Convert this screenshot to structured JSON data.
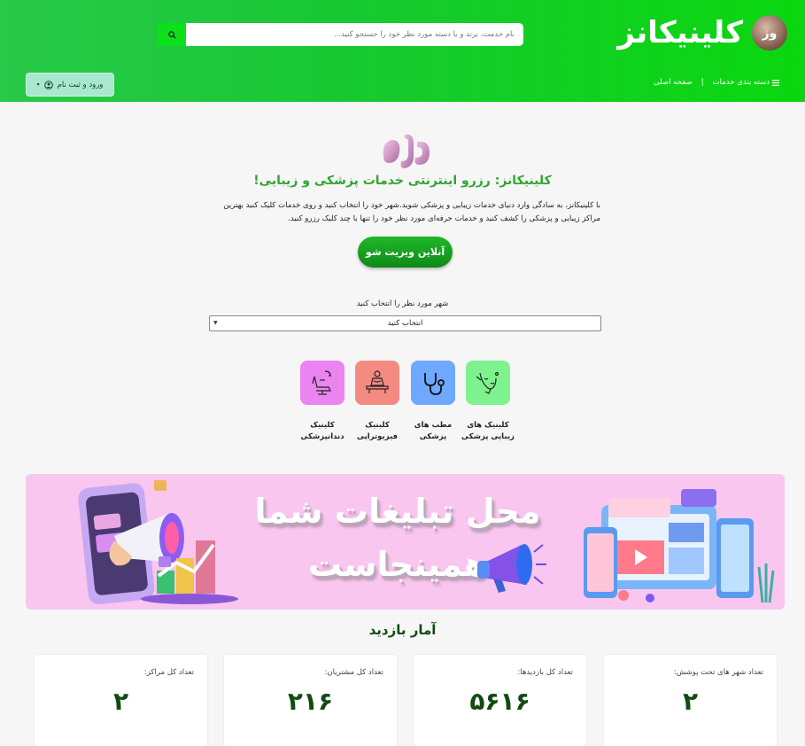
{
  "header": {
    "brand_name": "کلینیکانز",
    "search_placeholder": "نام خدمت، برند و یا دسته مورد نظر خود را جستجو کنید...",
    "nav": {
      "categories_label": "دسته بندی خدمات",
      "home_label": "صفحه اصلی"
    },
    "login_label": "ورود و ثبت نام"
  },
  "hero": {
    "title": "کلینیکانز: رزرو اینترنتی خدمات پزشکی و زیبایی!",
    "description": "با کلینیکانز، به سادگی وارد دنیای خدمات زیبایی و پزشکی شوید.شهر خود را انتخاب کنید و روی خدمات کلیک کنید بهترین مراکز زیبایی و پزشکی را کشف کنید و خدمات حرفه‌ای مورد نظر خود را تنها با چند کلیک رزرو کنید.",
    "cta_label": "آنلاین ویزیت شو"
  },
  "city": {
    "label": "شهر مورد نظر را انتخاب کنید",
    "selected": "انتخاب کنید"
  },
  "categories": [
    {
      "label": "کلینیک های زیبایی پزشکی",
      "icon": "beauty-face-icon",
      "color": "#7ef28f"
    },
    {
      "label": "مطب های پزشکی",
      "icon": "stethoscope-icon",
      "color": "#6fa8ff"
    },
    {
      "label": "کلینیک فیزیوتراپی",
      "icon": "physiotherapy-icon",
      "color": "#f58a80"
    },
    {
      "label": "کلینیک دندانپزشکی",
      "icon": "dental-chair-icon",
      "color": "#ea84f0"
    }
  ],
  "banner": {
    "line1": "محل تبلیغات شما",
    "line2": "همینجاست"
  },
  "stats": {
    "title": "آمار بازدید",
    "items": [
      {
        "label": "تعداد شهر های تحت پوشش:",
        "value": "۲"
      },
      {
        "label": "تعداد کل بازدیدها:",
        "value": "۵۶۱۶"
      },
      {
        "label": "تعداد کل مشتریان:",
        "value": "۲۱۶"
      },
      {
        "label": "تعداد کل مراکز:",
        "value": "۲"
      }
    ]
  },
  "colors": {
    "header_green": "#18c833",
    "accent_green": "#2fa62f",
    "stat_value": "#124b12",
    "banner_pink": "#f9c6ef"
  }
}
